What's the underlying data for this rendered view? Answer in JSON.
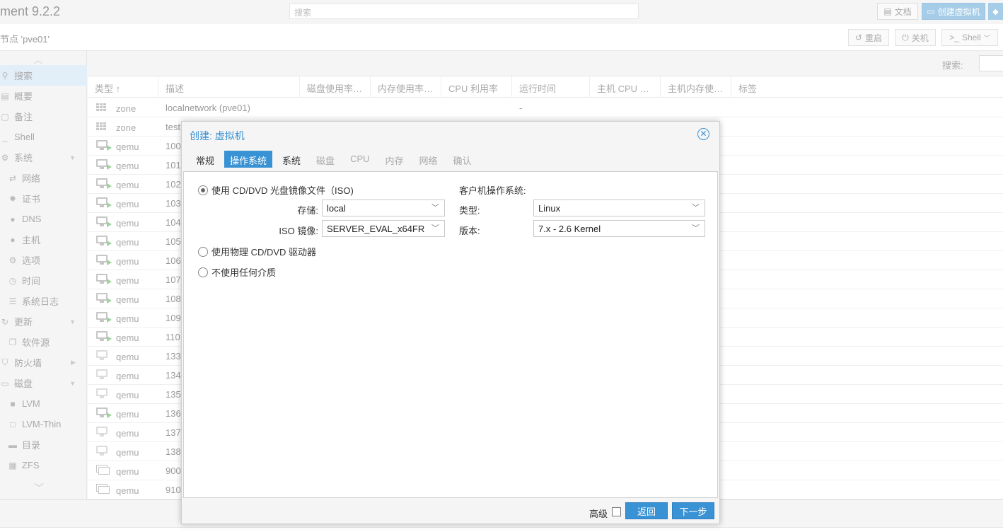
{
  "app": {
    "title": "ment 9.2.2",
    "search_placeholder": "搜索",
    "docs_label": "文档",
    "create_vm_label": "创建虚拟机"
  },
  "node": {
    "title": "节点 'pve01'",
    "reboot_label": "重启",
    "shutdown_label": "关机",
    "shell_label": "Shell"
  },
  "sidebar": {
    "items": [
      {
        "label": "搜索",
        "icon": "search-icon"
      },
      {
        "label": "概要",
        "icon": "book-icon"
      },
      {
        "label": "备注",
        "icon": "note-icon"
      },
      {
        "label": "Shell",
        "icon": "terminal-icon"
      },
      {
        "label": "系统",
        "icon": "cogs-icon"
      },
      {
        "label": "网络",
        "icon": "exchange-icon"
      },
      {
        "label": "证书",
        "icon": "certificate-icon"
      },
      {
        "label": "DNS",
        "icon": "globe-icon"
      },
      {
        "label": "主机",
        "icon": "globe-icon"
      },
      {
        "label": "选项",
        "icon": "gear-icon"
      },
      {
        "label": "时间",
        "icon": "clock-icon"
      },
      {
        "label": "系统日志",
        "icon": "list-icon"
      },
      {
        "label": "更新",
        "icon": "refresh-icon"
      },
      {
        "label": "软件源",
        "icon": "files-icon"
      },
      {
        "label": "防火墙",
        "icon": "shield-icon"
      },
      {
        "label": "磁盘",
        "icon": "hdd-icon"
      },
      {
        "label": "LVM",
        "icon": "square-icon"
      },
      {
        "label": "LVM-Thin",
        "icon": "square-outline-icon"
      },
      {
        "label": "目录",
        "icon": "folder-icon"
      },
      {
        "label": "ZFS",
        "icon": "th-large-icon"
      }
    ]
  },
  "main": {
    "search_label": "搜索:",
    "columns": [
      "类型 ↑",
      "描述",
      "磁盘使用率…",
      "内存使用率…",
      "CPU 利用率",
      "运行时间",
      "主机 CPU …",
      "主机内存使…",
      "标签"
    ],
    "rows": [
      {
        "type": "zone",
        "desc": "localnetwork (pve01)",
        "uptime": "-",
        "kind": "zone"
      },
      {
        "type": "zone",
        "desc": "test",
        "uptime": "",
        "kind": "zone"
      },
      {
        "type": "qemu",
        "desc": "100",
        "uptime": "",
        "kind": "running"
      },
      {
        "type": "qemu",
        "desc": "101",
        "uptime": "",
        "kind": "running"
      },
      {
        "type": "qemu",
        "desc": "102",
        "uptime": "",
        "kind": "running"
      },
      {
        "type": "qemu",
        "desc": "103",
        "uptime": "",
        "kind": "running"
      },
      {
        "type": "qemu",
        "desc": "104",
        "uptime": "",
        "kind": "running"
      },
      {
        "type": "qemu",
        "desc": "105",
        "uptime": "",
        "kind": "running"
      },
      {
        "type": "qemu",
        "desc": "106",
        "uptime": "",
        "kind": "running"
      },
      {
        "type": "qemu",
        "desc": "107",
        "uptime": "",
        "kind": "running"
      },
      {
        "type": "qemu",
        "desc": "108",
        "uptime": "",
        "kind": "running"
      },
      {
        "type": "qemu",
        "desc": "109",
        "uptime": "",
        "kind": "running"
      },
      {
        "type": "qemu",
        "desc": "110",
        "uptime": "",
        "kind": "running"
      },
      {
        "type": "qemu",
        "desc": "133",
        "uptime": "",
        "kind": "stopped"
      },
      {
        "type": "qemu",
        "desc": "134",
        "uptime": "",
        "kind": "stopped"
      },
      {
        "type": "qemu",
        "desc": "135",
        "uptime": "",
        "kind": "stopped"
      },
      {
        "type": "qemu",
        "desc": "136",
        "uptime": "",
        "kind": "running"
      },
      {
        "type": "qemu",
        "desc": "137",
        "uptime": "",
        "kind": "stopped"
      },
      {
        "type": "qemu",
        "desc": "138",
        "uptime": "",
        "kind": "stopped"
      },
      {
        "type": "qemu",
        "desc": "900",
        "uptime": "",
        "kind": "template"
      },
      {
        "type": "qemu",
        "desc": "910",
        "uptime": "",
        "kind": "template"
      }
    ]
  },
  "dialog": {
    "title": "创建: 虚拟机",
    "tabs": [
      {
        "label": "常规",
        "state": "normal"
      },
      {
        "label": "操作系统",
        "state": "active"
      },
      {
        "label": "系统",
        "state": "normal"
      },
      {
        "label": "磁盘",
        "state": "disabled"
      },
      {
        "label": "CPU",
        "state": "disabled"
      },
      {
        "label": "内存",
        "state": "disabled"
      },
      {
        "label": "网络",
        "state": "disabled"
      },
      {
        "label": "确认",
        "state": "disabled"
      }
    ],
    "media": {
      "iso_option": "使用 CD/DVD 光盘镜像文件（ISO)",
      "storage_label": "存储:",
      "storage_value": "local",
      "iso_label": "ISO 镜像:",
      "iso_value": "SERVER_EVAL_x64FR",
      "physical_option": "使用物理 CD/DVD 驱动器",
      "none_option": "不使用任何介质",
      "selected": "iso"
    },
    "guest": {
      "section_title": "客户机操作系统:",
      "type_label": "类型:",
      "type_value": "Linux",
      "version_label": "版本:",
      "version_value": "7.x - 2.6 Kernel"
    },
    "footer": {
      "advanced_label": "高级",
      "back_label": "返回",
      "next_label": "下一步"
    }
  }
}
